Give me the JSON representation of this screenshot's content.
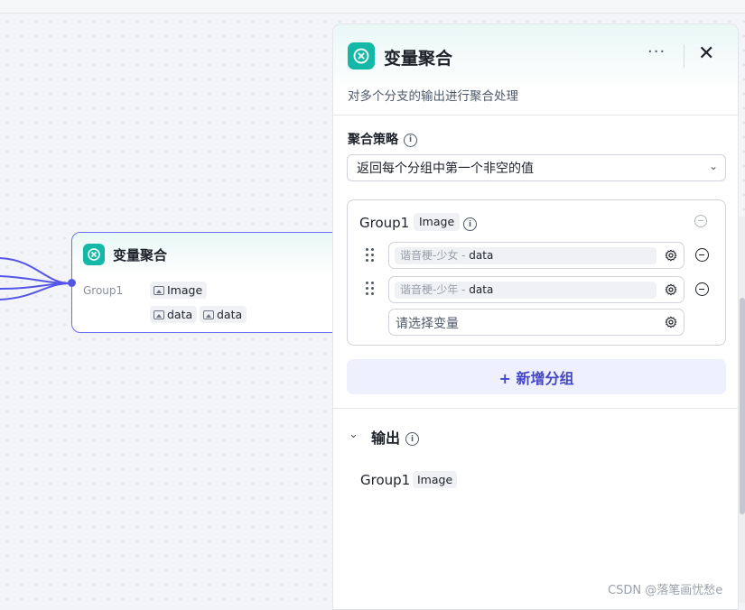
{
  "node": {
    "title": "变量聚合",
    "group_label": "Group1",
    "group_type": "Image",
    "vars": [
      "data",
      "data"
    ]
  },
  "panel": {
    "title": "变量聚合",
    "more_label": "···",
    "close_label": "✕",
    "description": "对多个分支的输出进行聚合处理",
    "strategy_label": "聚合策略",
    "strategy_value": "返回每个分组中第一个非空的值",
    "group": {
      "title": "Group1",
      "type": "Image",
      "variables": [
        {
          "source": "谐音梗-少女 - ",
          "name": "data"
        },
        {
          "source": "谐音梗-少年 - ",
          "name": "data"
        }
      ],
      "placeholder": "请选择变量"
    },
    "add_group_label": "+ 新增分组",
    "output": {
      "title": "输出",
      "group": "Group1",
      "type": "Image"
    }
  },
  "watermark": "CSDN @落笔画忧愁e",
  "colors": {
    "brand": "#14b8a6",
    "accent": "#4545c8",
    "edge": "#5555e8"
  },
  "icons": [
    "aggregate-icon",
    "info-icon",
    "chevron-down-icon",
    "minus-circle-icon",
    "drag-handle-icon",
    "gear-icon",
    "image-icon",
    "close-icon",
    "more-icon"
  ]
}
